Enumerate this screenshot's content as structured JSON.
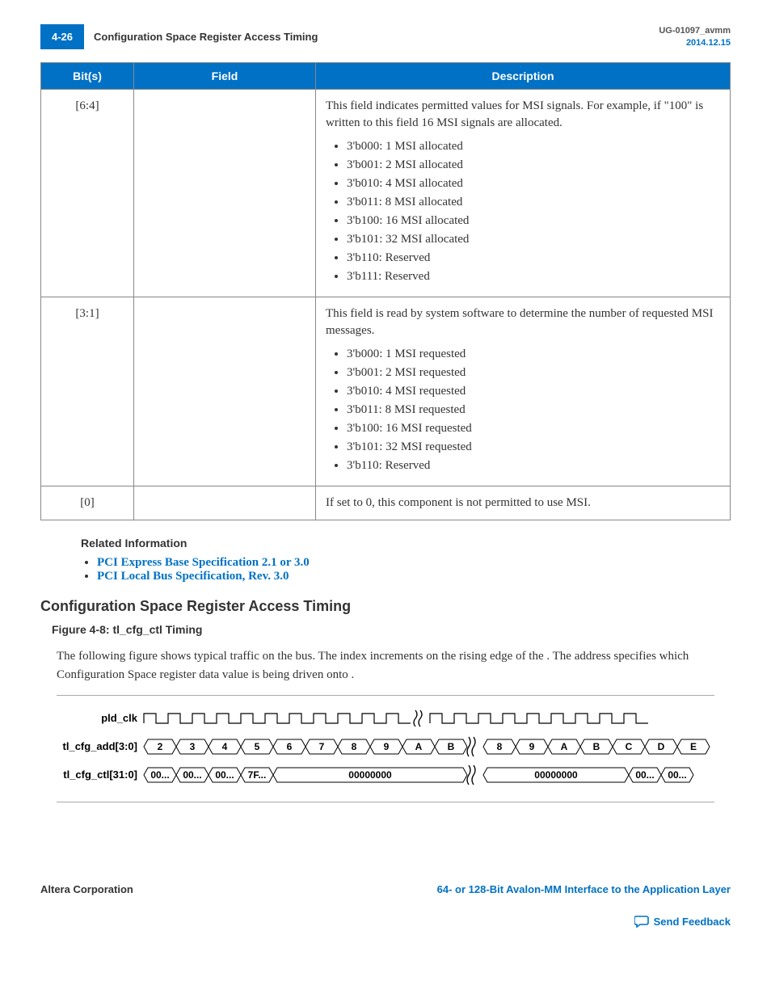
{
  "header": {
    "page_number": "4-26",
    "title": "Configuration Space Register Access Timing",
    "doc_id": "UG-01097_avmm",
    "date": "2014.12.15"
  },
  "table": {
    "columns": [
      "Bit(s)",
      "Field",
      "Description"
    ],
    "rows": [
      {
        "bits": "[6:4]",
        "field": "",
        "desc_intro": "This field indicates permitted values for MSI signals. For example, if \"100\" is written to this field 16 MSI signals are allocated.",
        "items": [
          "3'b000: 1 MSI allocated",
          "3'b001: 2 MSI allocated",
          "3'b010: 4 MSI allocated",
          "3'b011: 8 MSI allocated",
          "3'b100: 16 MSI allocated",
          "3'b101: 32 MSI allocated",
          "3'b110: Reserved",
          "3'b111: Reserved"
        ]
      },
      {
        "bits": "[3:1]",
        "field": "",
        "desc_intro": "This field is read by system software to determine the number of requested MSI messages.",
        "items": [
          "3'b000: 1 MSI requested",
          "3'b001: 2 MSI requested",
          "3'b010: 4 MSI requested",
          "3'b011: 8 MSI requested",
          "3'b100: 16 MSI requested",
          "3'b101: 32 MSI requested",
          "3'b110: Reserved"
        ]
      },
      {
        "bits": "[0]",
        "field": "",
        "desc_intro": "If set to 0, this component is not permitted to use MSI.",
        "items": []
      }
    ]
  },
  "related": {
    "heading": "Related Information",
    "links": [
      "PCI Express Base Specification 2.1 or 3.0",
      "PCI Local Bus Specification, Rev. 3.0"
    ]
  },
  "section": {
    "heading": "Configuration Space Register Access Timing",
    "figure_caption": "Figure 4-8: tl_cfg_ctl Timing",
    "figure_desc_1": "The following figure shows typical traffic on the ",
    "figure_desc_2": " bus. The ",
    "figure_desc_3": " index increments on the rising edge of the ",
    "figure_desc_4": ". The address specifies which Configuration Space register data value is being driven onto ",
    "figure_desc_5": "."
  },
  "timing": {
    "signals": [
      "pld_clk",
      "tl_cfg_add[3:0]",
      "tl_cfg_ctl[31:0]"
    ],
    "add_values": [
      "2",
      "3",
      "4",
      "5",
      "6",
      "7",
      "8",
      "9",
      "A",
      "B",
      "8",
      "9",
      "A",
      "B",
      "C",
      "D",
      "E"
    ],
    "ctl_values": [
      "00...",
      "00...",
      "00...",
      "7F...",
      "00000000",
      "00000000",
      "00...",
      "00..."
    ]
  },
  "footer": {
    "left": "Altera Corporation",
    "right": "64- or 128-Bit Avalon-MM Interface to the Application Layer",
    "feedback": "Send Feedback"
  }
}
